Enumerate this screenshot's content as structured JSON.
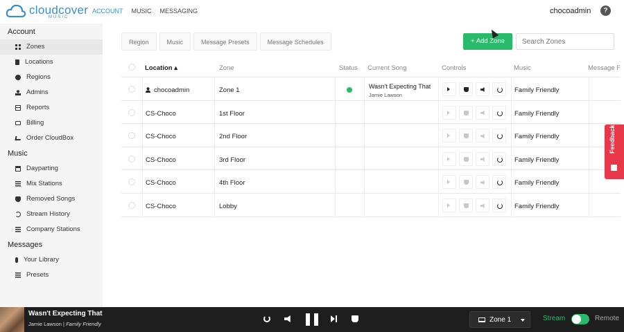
{
  "app": {
    "logo_text": "cloudcover",
    "logo_sub": "MUSIC",
    "nav": [
      {
        "label": "ACCOUNT",
        "active": true
      },
      {
        "label": "MUSIC",
        "active": false
      },
      {
        "label": "MESSAGING",
        "active": false
      }
    ],
    "username": "chocoadmin",
    "help_glyph": "?"
  },
  "sidebar": {
    "sections": [
      {
        "title": "Account",
        "items": [
          {
            "label": "Zones",
            "icon": "grid-icon",
            "active": true
          },
          {
            "label": "Locations",
            "icon": "book-icon"
          },
          {
            "label": "Regions",
            "icon": "globe-icon"
          },
          {
            "label": "Admins",
            "icon": "user-icon"
          },
          {
            "label": "Reports",
            "icon": "table-icon"
          },
          {
            "label": "Billing",
            "icon": "credit-card-icon"
          },
          {
            "label": "Order CloudBox",
            "icon": "cart-icon"
          }
        ]
      },
      {
        "title": "Music",
        "items": [
          {
            "label": "Dayparting",
            "icon": "calendar-icon"
          },
          {
            "label": "Mix Stations",
            "icon": "list-icon"
          },
          {
            "label": "Removed Songs",
            "icon": "thumbs-down-icon"
          },
          {
            "label": "Stream History",
            "icon": "history-icon"
          },
          {
            "label": "Company Stations",
            "icon": "list-icon"
          }
        ]
      },
      {
        "title": "Messages",
        "items": [
          {
            "label": "Your Library",
            "icon": "microphone-icon"
          },
          {
            "label": "Presets",
            "icon": "list-icon"
          }
        ]
      }
    ]
  },
  "toolbar": {
    "filters": [
      "Region",
      "Music",
      "Message Presets",
      "Message Schedules"
    ],
    "add_zone_label": "+ Add Zone",
    "search_placeholder": "Search Zones"
  },
  "table": {
    "columns": [
      "Location ▴",
      "Zone",
      "Status",
      "Current Song",
      "Controls",
      "Music",
      "Message F"
    ],
    "rows": [
      {
        "location": "chocoadmin",
        "user_icon": true,
        "zone": "Zone 1",
        "status": "online",
        "song": "Wasn't Expecting That",
        "artist": "Jamie Lawson",
        "music": "Family Friendly",
        "controls_enabled": true
      },
      {
        "location": "CS-Choco",
        "zone": "1st Floor",
        "status": "",
        "song": "",
        "artist": "",
        "music": "Family Friendly",
        "controls_enabled": false
      },
      {
        "location": "CS-Choco",
        "zone": "2nd Floor",
        "status": "",
        "song": "",
        "artist": "",
        "music": "Family Friendly",
        "controls_enabled": false
      },
      {
        "location": "CS-Choco",
        "zone": "3rd Floor",
        "status": "",
        "song": "",
        "artist": "",
        "music": "Family Friendly",
        "controls_enabled": false
      },
      {
        "location": "CS-Choco",
        "zone": "4th Floor",
        "status": "",
        "song": "",
        "artist": "",
        "music": "Family Friendly",
        "controls_enabled": false
      },
      {
        "location": "CS-Choco",
        "zone": "Lobby",
        "status": "",
        "song": "",
        "artist": "",
        "music": "Family Friendly",
        "controls_enabled": false
      }
    ]
  },
  "feedback_label": "Feedback",
  "player": {
    "song": "Wasn't Expecting That",
    "artist": "Jamie Lawson",
    "station": "Family Friendly",
    "separator": "|",
    "zone_label": "Zone 1",
    "stream_label": "Stream",
    "remote_label": "Remote",
    "stream_on": true
  },
  "colors": {
    "accent": "#3a8fc8",
    "green": "#2aba6b",
    "feedback": "#e8394b",
    "player_bg": "#1e1e1e"
  }
}
